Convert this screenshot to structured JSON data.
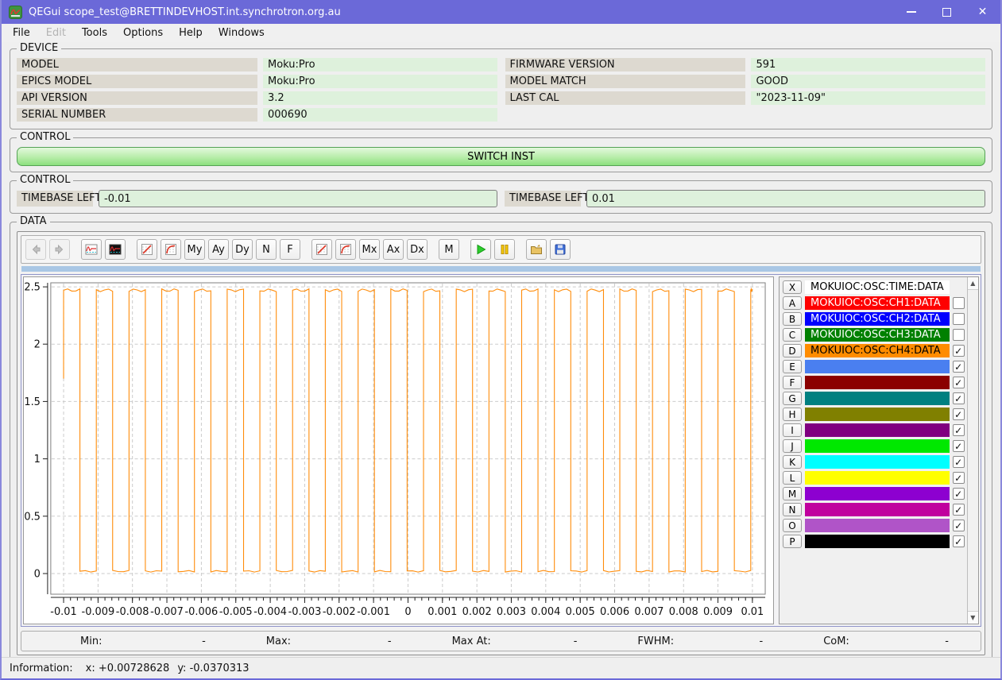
{
  "window": {
    "title": "QEGui scope_test@BRETTINDEVHOST.int.synchrotron.org.au"
  },
  "menu": {
    "items": [
      {
        "label": "File",
        "enabled": true
      },
      {
        "label": "Edit",
        "enabled": false
      },
      {
        "label": "Tools",
        "enabled": true
      },
      {
        "label": "Options",
        "enabled": true
      },
      {
        "label": "Help",
        "enabled": true
      },
      {
        "label": "Windows",
        "enabled": true
      }
    ]
  },
  "device": {
    "group_title": "DEVICE",
    "left_rows": [
      {
        "label": "MODEL",
        "value": "Moku:Pro"
      },
      {
        "label": "EPICS MODEL",
        "value": "Moku:Pro"
      },
      {
        "label": "API VERSION",
        "value": "3.2"
      },
      {
        "label": "SERIAL NUMBER",
        "value": "000690"
      }
    ],
    "right_rows": [
      {
        "label": "FIRMWARE VERSION",
        "value": "591"
      },
      {
        "label": "MODEL MATCH",
        "value": "GOOD"
      },
      {
        "label": "LAST CAL",
        "value": "\"2023-11-09\""
      }
    ]
  },
  "control_switch": {
    "group_title": "CONTROL",
    "switch_button_label": "SWITCH INST"
  },
  "control_timebase": {
    "group_title": "CONTROL",
    "fields": [
      {
        "label": "TIMEBASE LEFT",
        "value": "-0.01"
      },
      {
        "label": "TIMEBASE LEFT",
        "value": "0.01"
      }
    ]
  },
  "data_section": {
    "group_title": "DATA",
    "toolbar_labels": {
      "my": "My",
      "ay": "Ay",
      "dy": "Dy",
      "n": "N",
      "f": "F",
      "mx": "Mx",
      "ax": "Ax",
      "dx": "Dx",
      "m": "M"
    },
    "channels": [
      {
        "letter": "X",
        "pv": "MOKUIOC:OSC:TIME:DATA",
        "color": "#ffffff",
        "text_color": "#000000",
        "checkbox": null
      },
      {
        "letter": "A",
        "pv": "MOKUIOC:OSC:CH1:DATA",
        "color": "#fe0000",
        "text_color": "#ffffff",
        "checkbox": false
      },
      {
        "letter": "B",
        "pv": "MOKUIOC:OSC:CH2:DATA",
        "color": "#0000fe",
        "text_color": "#ffffff",
        "checkbox": false
      },
      {
        "letter": "C",
        "pv": "MOKUIOC:OSC:CH3:DATA",
        "color": "#008000",
        "text_color": "#ffffff",
        "checkbox": false
      },
      {
        "letter": "D",
        "pv": "MOKUIOC:OSC:CH4:DATA",
        "color": "#ff8c00",
        "text_color": "#000000",
        "checkbox": true
      },
      {
        "letter": "E",
        "pv": "",
        "color": "#4a7ff0",
        "text_color": "#000000",
        "checkbox": true
      },
      {
        "letter": "F",
        "pv": "",
        "color": "#8b0000",
        "text_color": "#ffffff",
        "checkbox": true
      },
      {
        "letter": "G",
        "pv": "",
        "color": "#008080",
        "text_color": "#ffffff",
        "checkbox": true
      },
      {
        "letter": "H",
        "pv": "",
        "color": "#808000",
        "text_color": "#ffffff",
        "checkbox": true
      },
      {
        "letter": "I",
        "pv": "",
        "color": "#800080",
        "text_color": "#ffffff",
        "checkbox": true
      },
      {
        "letter": "J",
        "pv": "",
        "color": "#00e800",
        "text_color": "#000000",
        "checkbox": true
      },
      {
        "letter": "K",
        "pv": "",
        "color": "#00ffff",
        "text_color": "#000000",
        "checkbox": true
      },
      {
        "letter": "L",
        "pv": "",
        "color": "#ffff00",
        "text_color": "#000000",
        "checkbox": true
      },
      {
        "letter": "M",
        "pv": "",
        "color": "#8d00d0",
        "text_color": "#ffffff",
        "checkbox": true
      },
      {
        "letter": "N",
        "pv": "",
        "color": "#c0009e",
        "text_color": "#ffffff",
        "checkbox": true
      },
      {
        "letter": "O",
        "pv": "",
        "color": "#b054c8",
        "text_color": "#ffffff",
        "checkbox": true
      },
      {
        "letter": "P",
        "pv": "",
        "color": "#000000",
        "text_color": "#ffffff",
        "checkbox": true
      }
    ],
    "stats": [
      {
        "label": "Min:",
        "value": "-"
      },
      {
        "label": "Max:",
        "value": "-"
      },
      {
        "label": "Max At:",
        "value": "-"
      },
      {
        "label": "FWHM:",
        "value": "-"
      },
      {
        "label": "CoM:",
        "value": "-"
      }
    ]
  },
  "chart_data": {
    "type": "line",
    "title": "",
    "xlabel": "",
    "ylabel": "",
    "xlim": [
      -0.010372,
      0.010372
    ],
    "ylim": [
      -0.18,
      2.535
    ],
    "x_ticks": [
      -0.01,
      -0.009,
      -0.008,
      -0.007,
      -0.006,
      -0.005,
      -0.004,
      -0.003,
      -0.002,
      -0.001,
      0,
      0.001,
      0.002,
      0.003,
      0.004,
      0.005,
      0.006,
      0.007,
      0.008,
      0.009,
      0.01
    ],
    "x_tick_labels": [
      "-0.01",
      "-0.009",
      "-0.008",
      "-0.007",
      "-0.006",
      "-0.005",
      "-0.004",
      "-0.003",
      "-0.002",
      "-0.001",
      "0",
      "0.001",
      "0.002",
      "0.003",
      "0.004",
      "0.005",
      "0.006",
      "0.007",
      "0.008",
      "0.009",
      "0.01"
    ],
    "x_minor_step": 0.0002,
    "y_ticks": [
      0,
      0.5,
      1,
      1.5,
      2,
      2.5
    ],
    "grid": true,
    "legend": "none",
    "series": [
      {
        "name": "MOKUIOC:OSC:CH4:DATA",
        "color": "#ff8c0a",
        "waveform": "square",
        "t_start": -0.01,
        "t_end": 0.01,
        "period_s": 0.00095,
        "duty": 0.5,
        "high": 2.47,
        "low": 0.02,
        "first_sample_value": 1.7
      }
    ]
  },
  "status_bar": {
    "label": "Information:",
    "x_readout": "x: +0.00728628",
    "y_readout": "y: -0.0370313"
  }
}
